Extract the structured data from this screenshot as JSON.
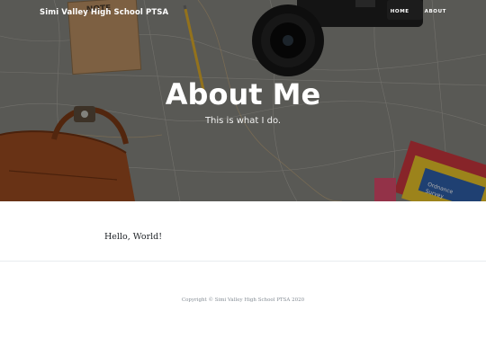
{
  "site": {
    "brand": "Simi Valley High School PTSA"
  },
  "nav": {
    "items": [
      "HOME",
      "ABOUT"
    ]
  },
  "header": {
    "title": "About Me",
    "subtitle": "This is what I do."
  },
  "main": {
    "body_text": "Hello, World!"
  },
  "footer": {
    "copyright": "Copyright © Simi Valley High School PTSA 2020"
  },
  "hero_image": {
    "description_items": [
      "map-background",
      "notebook",
      "pencil",
      "camera",
      "leather-bag",
      "map-booklets"
    ]
  },
  "colors": {
    "text_dark": "#212529",
    "footer_text": "#868e96",
    "divider": "#e9ecef",
    "bag": "#9a4a1f",
    "booklet_red": "#c8353d",
    "booklet_yellow": "#e6c229"
  }
}
